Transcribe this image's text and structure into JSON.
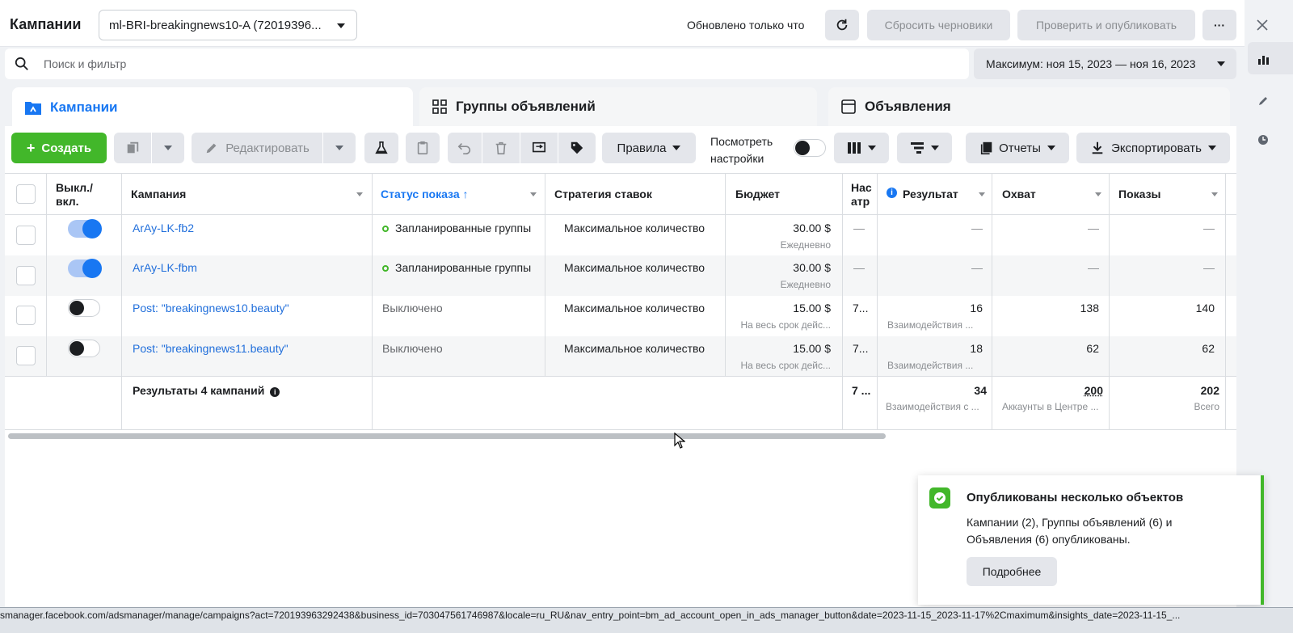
{
  "header": {
    "title": "Кампании",
    "account": "ml-BRI-breakingnews10-A (72019396...",
    "updated": "Обновлено только что",
    "reset_label": "Сбросить черновики",
    "publish_label": "Проверить и опубликовать",
    "more_label": "···"
  },
  "search": {
    "placeholder": "Поиск и фильтр",
    "date_range": "Максимум: ноя 15, 2023 — ноя 16, 2023"
  },
  "tabs": [
    {
      "label": "Кампании"
    },
    {
      "label": "Группы объявлений"
    },
    {
      "label": "Объявления"
    }
  ],
  "toolbar": {
    "create": "Создать",
    "edit": "Редактировать",
    "rules": "Правила",
    "view_settings_1": "Посмотреть",
    "view_settings_2": "настройки",
    "reports": "Отчеты",
    "export": "Экспортировать"
  },
  "columns": {
    "toggle_1": "Выкл./",
    "toggle_2": "вкл.",
    "campaign": "Кампания",
    "status": "Статус показа ↑",
    "bid": "Стратегия ставок",
    "budget": "Бюджет",
    "attr_1": "Нас",
    "attr_2": "атр",
    "result": "Результат",
    "reach": "Охват",
    "impressions": "Показы"
  },
  "rows": [
    {
      "name": "ArAy-LK-fb2",
      "on": true,
      "status": "Запланированные группы",
      "bid": "Максимальное количество",
      "budget": "30.00 $",
      "budget_sub": "Ежедневно",
      "attr": "—",
      "result": "—",
      "result_sub": "",
      "reach": "—",
      "impressions": "—"
    },
    {
      "name": "ArAy-LK-fbm",
      "on": true,
      "status": "Запланированные группы",
      "bid": "Максимальное количество",
      "budget": "30.00 $",
      "budget_sub": "Ежедневно",
      "attr": "—",
      "result": "—",
      "result_sub": "",
      "reach": "—",
      "impressions": "—"
    },
    {
      "name": "Post: \"breakingnews10.beauty\"",
      "on": false,
      "status": "Выключено",
      "bid": "Максимальное количество",
      "budget": "15.00 $",
      "budget_sub": "На весь срок дейс...",
      "attr": "7...",
      "result": "16",
      "result_sub": "Взаимодействия ...",
      "reach": "138",
      "impressions": "140"
    },
    {
      "name": "Post: \"breakingnews11.beauty\"",
      "on": false,
      "status": "Выключено",
      "bid": "Максимальное количество",
      "budget": "15.00 $",
      "budget_sub": "На весь срок дейс...",
      "attr": "7...",
      "result": "18",
      "result_sub": "Взаимодействия ...",
      "reach": "62",
      "impressions": "62"
    }
  ],
  "totals": {
    "label": "Результаты 4 кампаний",
    "attr": "7 ...",
    "result": "34",
    "result_sub": "Взаимодействия с ...",
    "reach": "200",
    "reach_sub": "Аккаунты в Центре ...",
    "impressions": "202",
    "impressions_sub": "Всего"
  },
  "toast": {
    "title": "Опубликованы несколько объектов",
    "body": "Кампании (2), Группы объявлений (6) и Объявления (6) опубликованы.",
    "button": "Подробнее"
  },
  "statusbar": {
    "url": "smanager.facebook.com/adsmanager/manage/campaigns?act=720193963292438&business_id=703047561746987&locale=ru_RU&nav_entry_point=bm_ad_account_open_in_ads_manager_button&date=2023-11-15_2023-11-17%2Cmaximum&insights_date=2023-11-15_..."
  },
  "colors": {
    "accent": "#1877f2",
    "create": "#42b72a",
    "link": "#216fdb"
  }
}
